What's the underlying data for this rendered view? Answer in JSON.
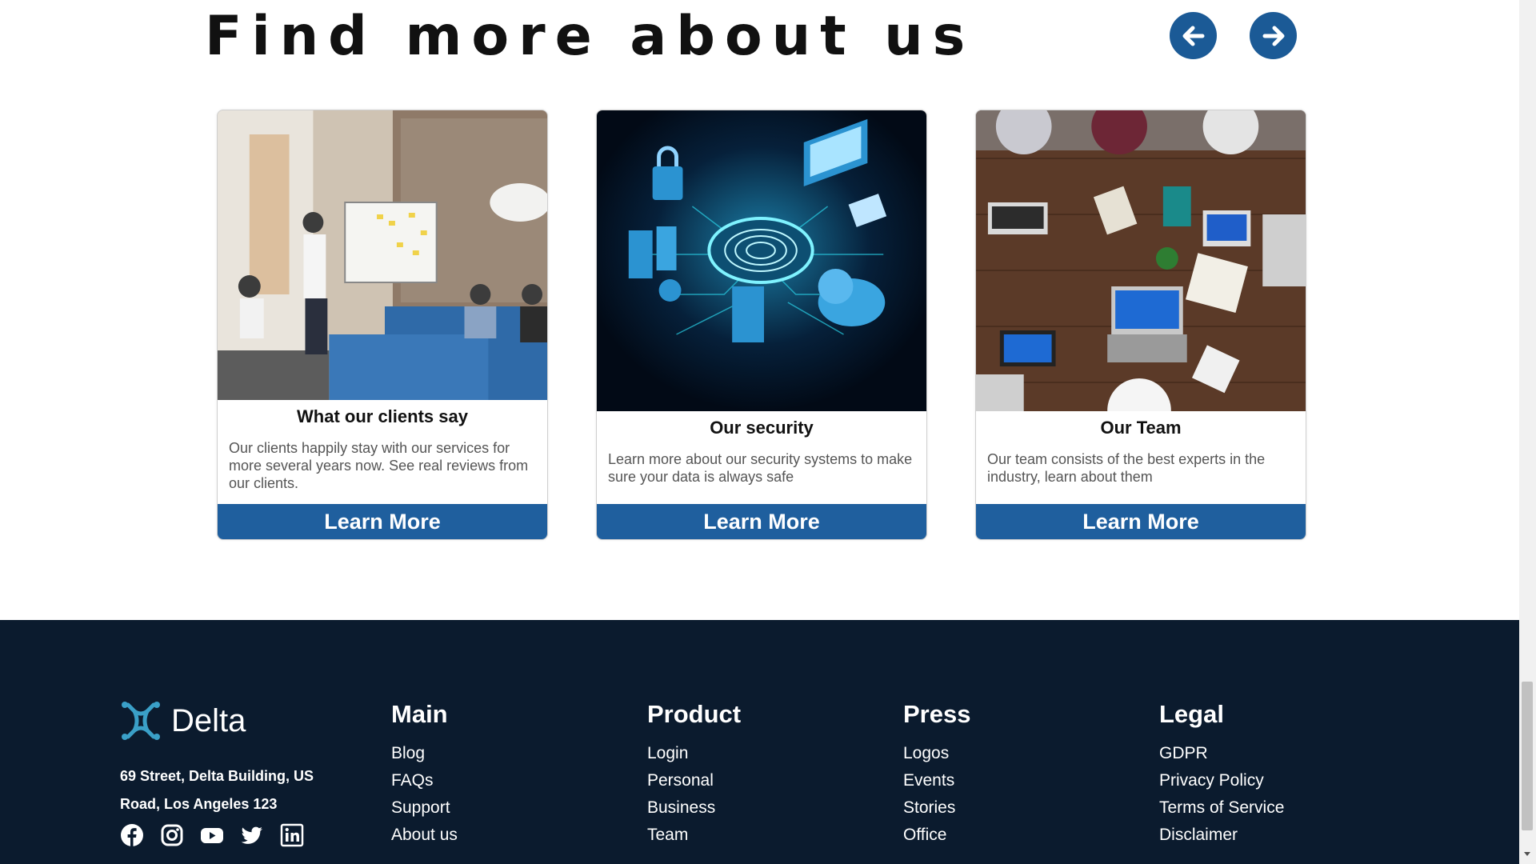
{
  "section": {
    "title": "Find more about us"
  },
  "cards": [
    {
      "title": "What our clients say",
      "text": "Our clients happily stay with our services for more several years now. See real reviews from our clients.",
      "button": "Learn More"
    },
    {
      "title": "Our security",
      "text": "Learn more about our security systems to make sure your data is always safe",
      "button": "Learn More"
    },
    {
      "title": "Our Team",
      "text": "Our team consists of the best experts in the industry, learn about them",
      "button": "Learn More"
    }
  ],
  "footer": {
    "brand": "Delta",
    "address_line1": "69 Street, Delta Building, US",
    "address_line2": "Road, Los Angeles 123",
    "socials": [
      "facebook-icon",
      "instagram-icon",
      "youtube-icon",
      "twitter-icon",
      "linkedin-icon"
    ],
    "columns": {
      "main": {
        "title": "Main",
        "items": [
          "Blog",
          "FAQs",
          "Support",
          "About us"
        ]
      },
      "product": {
        "title": "Product",
        "items": [
          "Login",
          "Personal",
          "Business",
          "Team"
        ]
      },
      "press": {
        "title": "Press",
        "items": [
          "Logos",
          "Events",
          "Stories",
          "Office"
        ]
      },
      "legal": {
        "title": "Legal",
        "items": [
          "GDPR",
          "Privacy Policy",
          "Terms of Service",
          "Disclaimer"
        ]
      }
    }
  },
  "colors": {
    "accent": "#1f5f9e",
    "nav_button": "#1b5a96",
    "footer_bg": "#0b1b2e",
    "logo": "#3aa0c8"
  }
}
